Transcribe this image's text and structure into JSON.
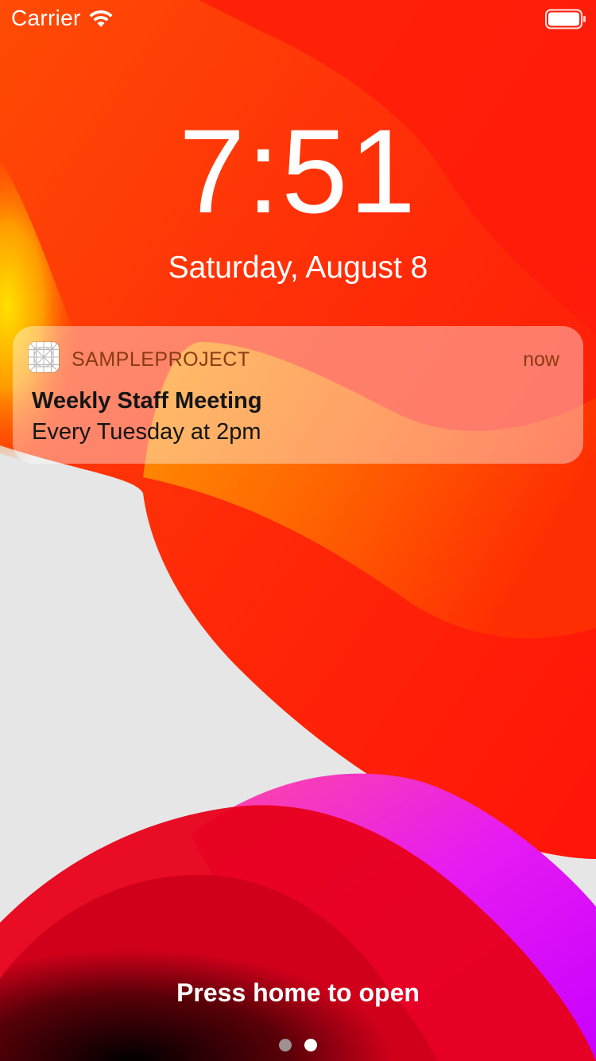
{
  "status_bar": {
    "carrier": "Carrier",
    "wifi_icon": "wifi-icon",
    "battery_icon": "battery-icon"
  },
  "lock_screen": {
    "time": "7:51",
    "date": "Saturday, August 8"
  },
  "notification": {
    "app_icon": "app-grid-icon",
    "app_name": "SAMPLEPROJECT",
    "time": "now",
    "title": "Weekly Staff Meeting",
    "body": "Every Tuesday at 2pm"
  },
  "bottom": {
    "unlock_hint": "Press home to open",
    "page_count": 2,
    "current_page": 2
  },
  "colors": {
    "wallpaper_red": "#ff1a0a",
    "wallpaper_orange": "#ff6a00",
    "wallpaper_yellow": "#ffd400",
    "wallpaper_magenta": "#e61bf2",
    "background_gray": "#e6e6e6",
    "notification_text_accent": "#8a3a12"
  }
}
